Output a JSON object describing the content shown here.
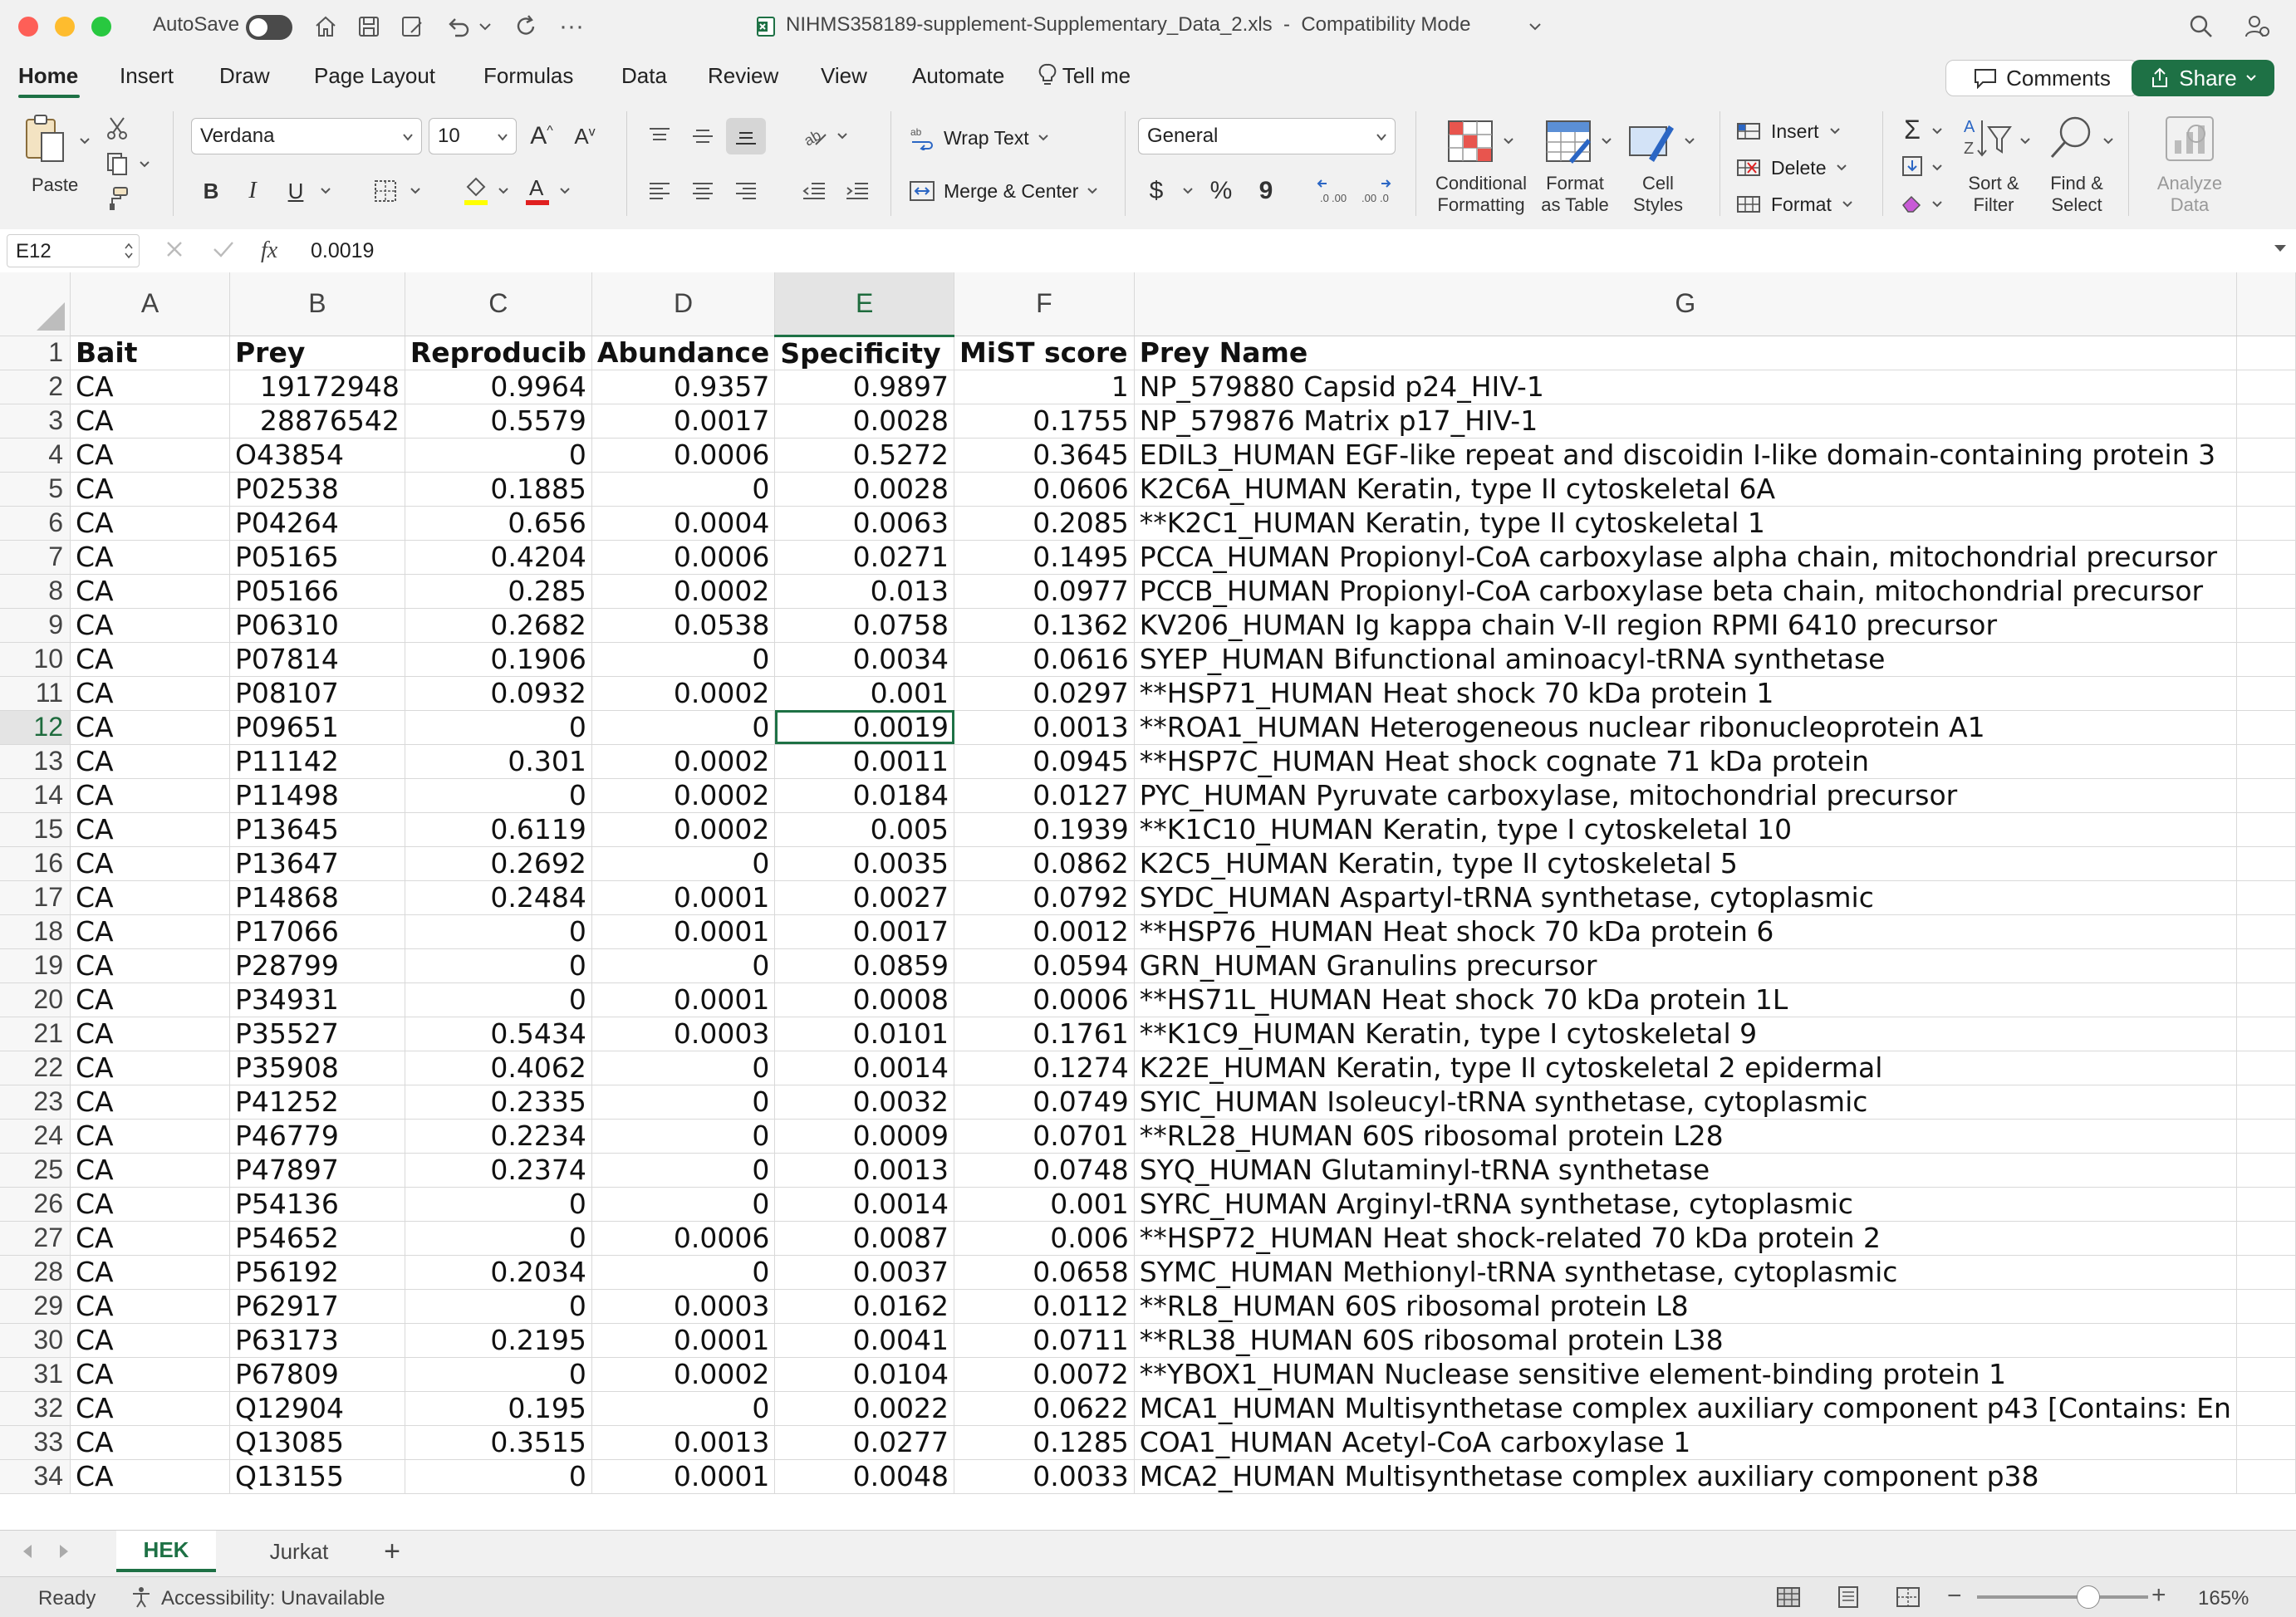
{
  "window": {
    "autosave_label": "AutoSave",
    "title": "NIHMS358189-supplement-Supplementary_Data_2.xls",
    "mode": "Compatibility Mode"
  },
  "ribbon_tabs": [
    "Home",
    "Insert",
    "Draw",
    "Page Layout",
    "Formulas",
    "Data",
    "Review",
    "View",
    "Automate"
  ],
  "tell_me": "Tell me",
  "comments_label": "Comments",
  "share_label": "Share",
  "ribbon": {
    "paste": "Paste",
    "font_name": "Verdana",
    "font_size": "10",
    "bold": "B",
    "italic": "I",
    "underline": "U",
    "wrap_text": "Wrap Text",
    "merge_center": "Merge & Center",
    "number_format": "General",
    "currency": "$",
    "percent": "%",
    "comma": "9",
    "conditional_formatting": [
      "Conditional",
      "Formatting"
    ],
    "format_as_table": [
      "Format",
      "as Table"
    ],
    "cell_styles": [
      "Cell",
      "Styles"
    ],
    "insert": "Insert",
    "delete": "Delete",
    "format": "Format",
    "sort_filter": [
      "Sort &",
      "Filter"
    ],
    "find_select": [
      "Find &",
      "Select"
    ],
    "analyze_data": [
      "Analyze",
      "Data"
    ]
  },
  "formula_bar": {
    "cell_ref": "E12",
    "fx": "fx",
    "value": "0.0019"
  },
  "columns": [
    "A",
    "B",
    "C",
    "D",
    "E",
    "F",
    "G"
  ],
  "header_row": [
    "Bait",
    "Prey",
    "Reproducib",
    "Abundance",
    "Specificity",
    "MiST score",
    "Prey Name"
  ],
  "rows": [
    [
      "CA",
      "19172948",
      "0.9964",
      "0.9357",
      "0.9897",
      "1",
      "NP_579880 Capsid p24_HIV-1"
    ],
    [
      "CA",
      "28876542",
      "0.5579",
      "0.0017",
      "0.0028",
      "0.1755",
      "NP_579876 Matrix p17_HIV-1"
    ],
    [
      "CA",
      "O43854",
      "0",
      "0.0006",
      "0.5272",
      "0.3645",
      "EDIL3_HUMAN EGF-like repeat and discoidin I-like domain-containing protein 3"
    ],
    [
      "CA",
      "P02538",
      "0.1885",
      "0",
      "0.0028",
      "0.0606",
      "K2C6A_HUMAN Keratin, type II cytoskeletal 6A"
    ],
    [
      "CA",
      "P04264",
      "0.656",
      "0.0004",
      "0.0063",
      "0.2085",
      "**K2C1_HUMAN Keratin, type II cytoskeletal 1"
    ],
    [
      "CA",
      "P05165",
      "0.4204",
      "0.0006",
      "0.0271",
      "0.1495",
      "PCCA_HUMAN Propionyl-CoA carboxylase alpha chain, mitochondrial precursor"
    ],
    [
      "CA",
      "P05166",
      "0.285",
      "0.0002",
      "0.013",
      "0.0977",
      "PCCB_HUMAN Propionyl-CoA carboxylase beta chain, mitochondrial precursor"
    ],
    [
      "CA",
      "P06310",
      "0.2682",
      "0.0538",
      "0.0758",
      "0.1362",
      "KV206_HUMAN Ig kappa chain V-II region RPMI 6410 precursor"
    ],
    [
      "CA",
      "P07814",
      "0.1906",
      "0",
      "0.0034",
      "0.0616",
      "SYEP_HUMAN Bifunctional aminoacyl-tRNA synthetase"
    ],
    [
      "CA",
      "P08107",
      "0.0932",
      "0.0002",
      "0.001",
      "0.0297",
      "**HSP71_HUMAN Heat shock 70 kDa protein 1"
    ],
    [
      "CA",
      "P09651",
      "0",
      "0",
      "0.0019",
      "0.0013",
      "**ROA1_HUMAN Heterogeneous nuclear ribonucleoprotein A1"
    ],
    [
      "CA",
      "P11142",
      "0.301",
      "0.0002",
      "0.0011",
      "0.0945",
      "**HSP7C_HUMAN Heat shock cognate 71 kDa protein"
    ],
    [
      "CA",
      "P11498",
      "0",
      "0.0002",
      "0.0184",
      "0.0127",
      "PYC_HUMAN Pyruvate carboxylase, mitochondrial precursor"
    ],
    [
      "CA",
      "P13645",
      "0.6119",
      "0.0002",
      "0.005",
      "0.1939",
      "**K1C10_HUMAN Keratin, type I cytoskeletal 10"
    ],
    [
      "CA",
      "P13647",
      "0.2692",
      "0",
      "0.0035",
      "0.0862",
      "K2C5_HUMAN Keratin, type II cytoskeletal 5"
    ],
    [
      "CA",
      "P14868",
      "0.2484",
      "0.0001",
      "0.0027",
      "0.0792",
      "SYDC_HUMAN Aspartyl-tRNA synthetase, cytoplasmic"
    ],
    [
      "CA",
      "P17066",
      "0",
      "0.0001",
      "0.0017",
      "0.0012",
      "**HSP76_HUMAN Heat shock 70 kDa protein 6"
    ],
    [
      "CA",
      "P28799",
      "0",
      "0",
      "0.0859",
      "0.0594",
      "GRN_HUMAN Granulins precursor"
    ],
    [
      "CA",
      "P34931",
      "0",
      "0.0001",
      "0.0008",
      "0.0006",
      "**HS71L_HUMAN Heat shock 70 kDa protein 1L"
    ],
    [
      "CA",
      "P35527",
      "0.5434",
      "0.0003",
      "0.0101",
      "0.1761",
      "**K1C9_HUMAN Keratin, type I cytoskeletal 9"
    ],
    [
      "CA",
      "P35908",
      "0.4062",
      "0",
      "0.0014",
      "0.1274",
      "K22E_HUMAN Keratin, type II cytoskeletal 2 epidermal"
    ],
    [
      "CA",
      "P41252",
      "0.2335",
      "0",
      "0.0032",
      "0.0749",
      "SYIC_HUMAN Isoleucyl-tRNA synthetase, cytoplasmic"
    ],
    [
      "CA",
      "P46779",
      "0.2234",
      "0",
      "0.0009",
      "0.0701",
      "**RL28_HUMAN 60S ribosomal protein L28"
    ],
    [
      "CA",
      "P47897",
      "0.2374",
      "0",
      "0.0013",
      "0.0748",
      "SYQ_HUMAN Glutaminyl-tRNA synthetase"
    ],
    [
      "CA",
      "P54136",
      "0",
      "0",
      "0.0014",
      "0.001",
      "SYRC_HUMAN Arginyl-tRNA synthetase, cytoplasmic"
    ],
    [
      "CA",
      "P54652",
      "0",
      "0.0006",
      "0.0087",
      "0.006",
      "**HSP72_HUMAN Heat shock-related 70 kDa protein 2"
    ],
    [
      "CA",
      "P56192",
      "0.2034",
      "0",
      "0.0037",
      "0.0658",
      "SYMC_HUMAN Methionyl-tRNA synthetase, cytoplasmic"
    ],
    [
      "CA",
      "P62917",
      "0",
      "0.0003",
      "0.0162",
      "0.0112",
      "**RL8_HUMAN 60S ribosomal protein L8"
    ],
    [
      "CA",
      "P63173",
      "0.2195",
      "0.0001",
      "0.0041",
      "0.0711",
      "**RL38_HUMAN 60S ribosomal protein L38"
    ],
    [
      "CA",
      "P67809",
      "0",
      "0.0002",
      "0.0104",
      "0.0072",
      "**YBOX1_HUMAN Nuclease sensitive element-binding protein 1"
    ],
    [
      "CA",
      "Q12904",
      "0.195",
      "0",
      "0.0022",
      "0.0622",
      "MCA1_HUMAN Multisynthetase complex auxiliary component p43 [Contains: En"
    ],
    [
      "CA",
      "Q13085",
      "0.3515",
      "0.0013",
      "0.0277",
      "0.1285",
      "COA1_HUMAN Acetyl-CoA carboxylase 1"
    ],
    [
      "CA",
      "Q13155",
      "0",
      "0.0001",
      "0.0048",
      "0.0033",
      "MCA2_HUMAN Multisynthetase complex auxiliary component p38"
    ]
  ],
  "sheet_tabs": [
    "HEK",
    "Jurkat"
  ],
  "active_sheet": "HEK",
  "status": {
    "ready": "Ready",
    "accessibility": "Accessibility: Unavailable",
    "zoom": "165%",
    "zoom_level": 0.65
  }
}
